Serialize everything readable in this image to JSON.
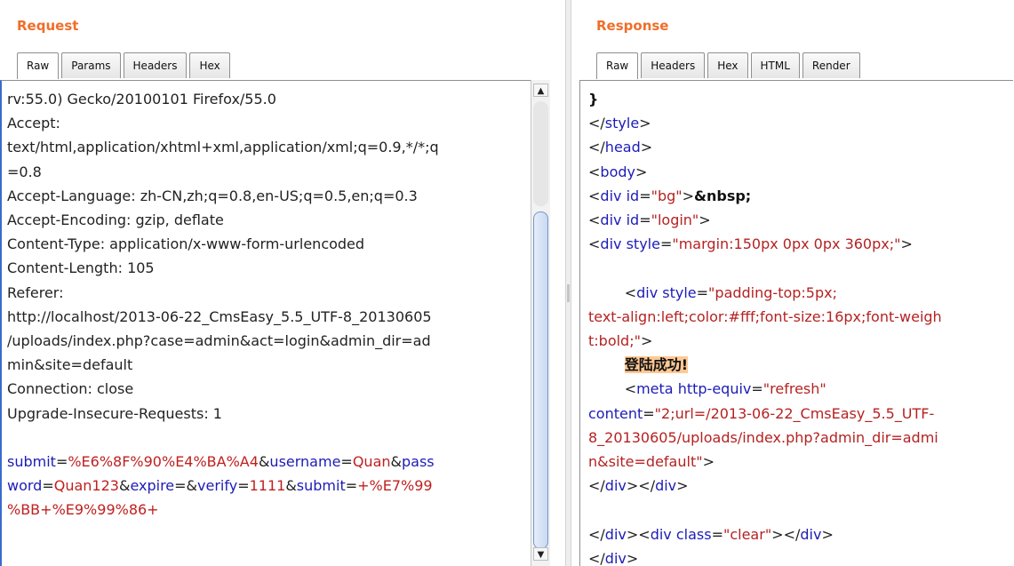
{
  "request": {
    "title": "Request",
    "tabs": [
      "Raw",
      "Params",
      "Headers",
      "Hex"
    ],
    "active_tab": "Raw",
    "lines": [
      "rv:55.0) Gecko/20100101 Firefox/55.0",
      "Accept:",
      "text/html,application/xhtml+xml,application/xml;q=0.9,*/*;q",
      "=0.8",
      "Accept-Language: zh-CN,zh;q=0.8,en-US;q=0.5,en;q=0.3",
      "Accept-Encoding: gzip, deflate",
      "Content-Type: application/x-www-form-urlencoded",
      "Content-Length: 105",
      "Referer:",
      "http://localhost/2013-06-22_CmsEasy_5.5_UTF-8_20130605",
      "/uploads/index.php?case=admin&act=login&admin_dir=ad",
      "min&site=default",
      "Connection: close",
      "Upgrade-Insecure-Requests: 1"
    ],
    "body": {
      "p1_name": "submit",
      "p1_value": "%E6%8F%90%E4%BA%A4",
      "p2_name": "username",
      "p2_value": "Quan",
      "p3_name_a": "pass",
      "p3_name_b": "word",
      "p3_value": "Quan123",
      "p4_name": "expire",
      "p4_value": "",
      "p5_name": "verify",
      "p5_value": "1111",
      "p6_name": "submit",
      "p6_value_a": "+%E7%99",
      "p6_value_b": "%BB+%E9%99%86+"
    }
  },
  "response": {
    "title": "Response",
    "tabs": [
      "Raw",
      "Headers",
      "Hex",
      "HTML",
      "Render"
    ],
    "active_tab": "Raw",
    "brace": "}",
    "style_tag": "style",
    "head_tag": "head",
    "body_tag": "body",
    "div_tag": "div",
    "meta_tag": "meta",
    "id_attr": "id",
    "style_attr": "style",
    "class_attr": "class",
    "http_equiv_attr": "http-equiv",
    "content_attr": "content",
    "bg_value": "\"bg\"",
    "nbsp": "&nbsp;",
    "login_value": "\"login\"",
    "margin_value": "\"margin:150px 0px 0px 360px;\"",
    "padding_value_a": "\"padding-top:5px;",
    "padding_value_b": "text-align:left;color:#fff;font-size:16px;font-weigh",
    "padding_value_c": "t:bold;\"",
    "success_text": "登陆成功!",
    "refresh_value": "\"refresh\"",
    "content_value_a": "\"2;url=/2013-06-22_CmsEasy_5.5_UTF-",
    "content_value_b": "8_20130605/uploads/index.php?admin_dir=admi",
    "content_value_c": "n&site=default\"",
    "clear_value": "\"clear\""
  }
}
